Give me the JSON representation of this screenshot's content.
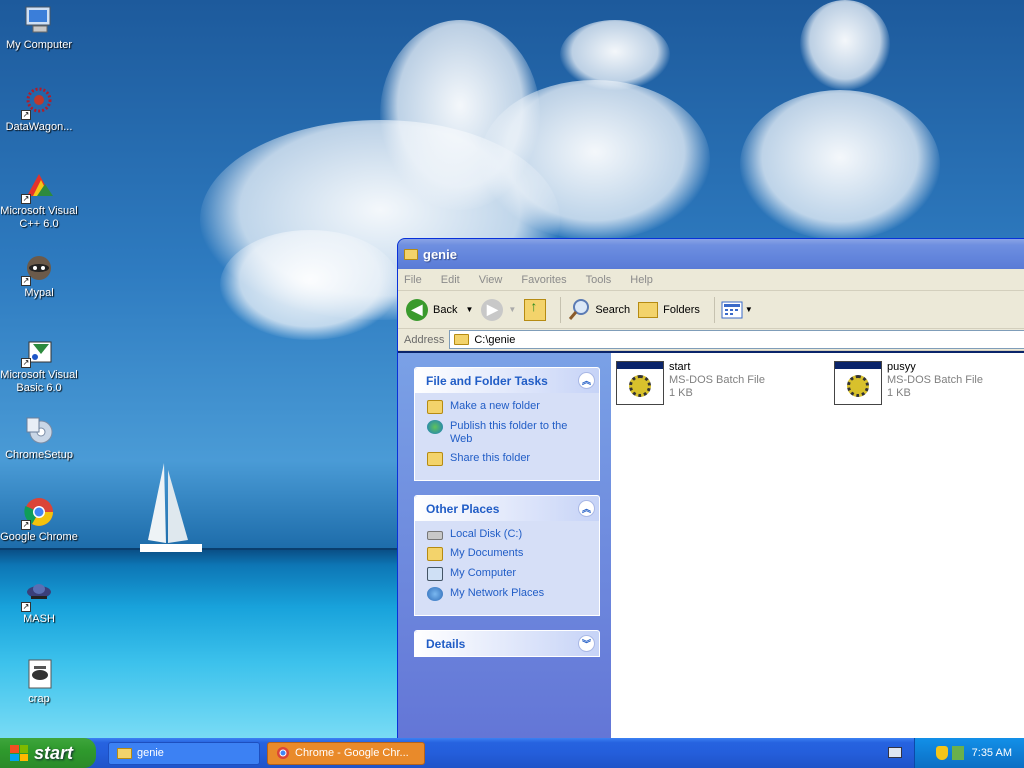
{
  "desktop": {
    "icons": [
      {
        "label": "My Computer",
        "icon": "my-computer-icon"
      },
      {
        "label": "DataWagon...",
        "icon": "datawagon-icon"
      },
      {
        "label": "Microsoft Visual C++ 6.0",
        "icon": "visual-cpp-icon"
      },
      {
        "label": "Mypal",
        "icon": "mypal-icon"
      },
      {
        "label": "Microsoft Visual Basic 6.0",
        "icon": "visual-basic-icon"
      },
      {
        "label": "ChromeSetup",
        "icon": "chrome-setup-icon"
      },
      {
        "label": "Google Chrome",
        "icon": "chrome-icon"
      },
      {
        "label": "MASH",
        "icon": "mash-icon"
      },
      {
        "label": "crap",
        "icon": "notepad-file-icon"
      }
    ]
  },
  "window": {
    "title": "genie",
    "menu": [
      "File",
      "Edit",
      "View",
      "Favorites",
      "Tools",
      "Help"
    ],
    "toolbar": {
      "back": "Back",
      "search": "Search",
      "folders": "Folders"
    },
    "address": {
      "label": "Address",
      "value": "C:\\genie"
    },
    "tasks": {
      "file_folder": {
        "title": "File and Folder Tasks",
        "items": [
          "Make a new folder",
          "Publish this folder to the Web",
          "Share this folder"
        ]
      },
      "other_places": {
        "title": "Other Places",
        "items": [
          "Local Disk (C:)",
          "My Documents",
          "My Computer",
          "My Network Places"
        ]
      },
      "details": {
        "title": "Details"
      }
    },
    "files": [
      {
        "name": "start",
        "type": "MS-DOS Batch File",
        "size": "1 KB"
      },
      {
        "name": "pusyy",
        "type": "MS-DOS Batch File",
        "size": "1 KB"
      }
    ]
  },
  "taskbar": {
    "start": "start",
    "items": [
      {
        "label": "genie"
      },
      {
        "label": "Chrome - Google Chr..."
      }
    ],
    "clock": "7:35 AM"
  }
}
